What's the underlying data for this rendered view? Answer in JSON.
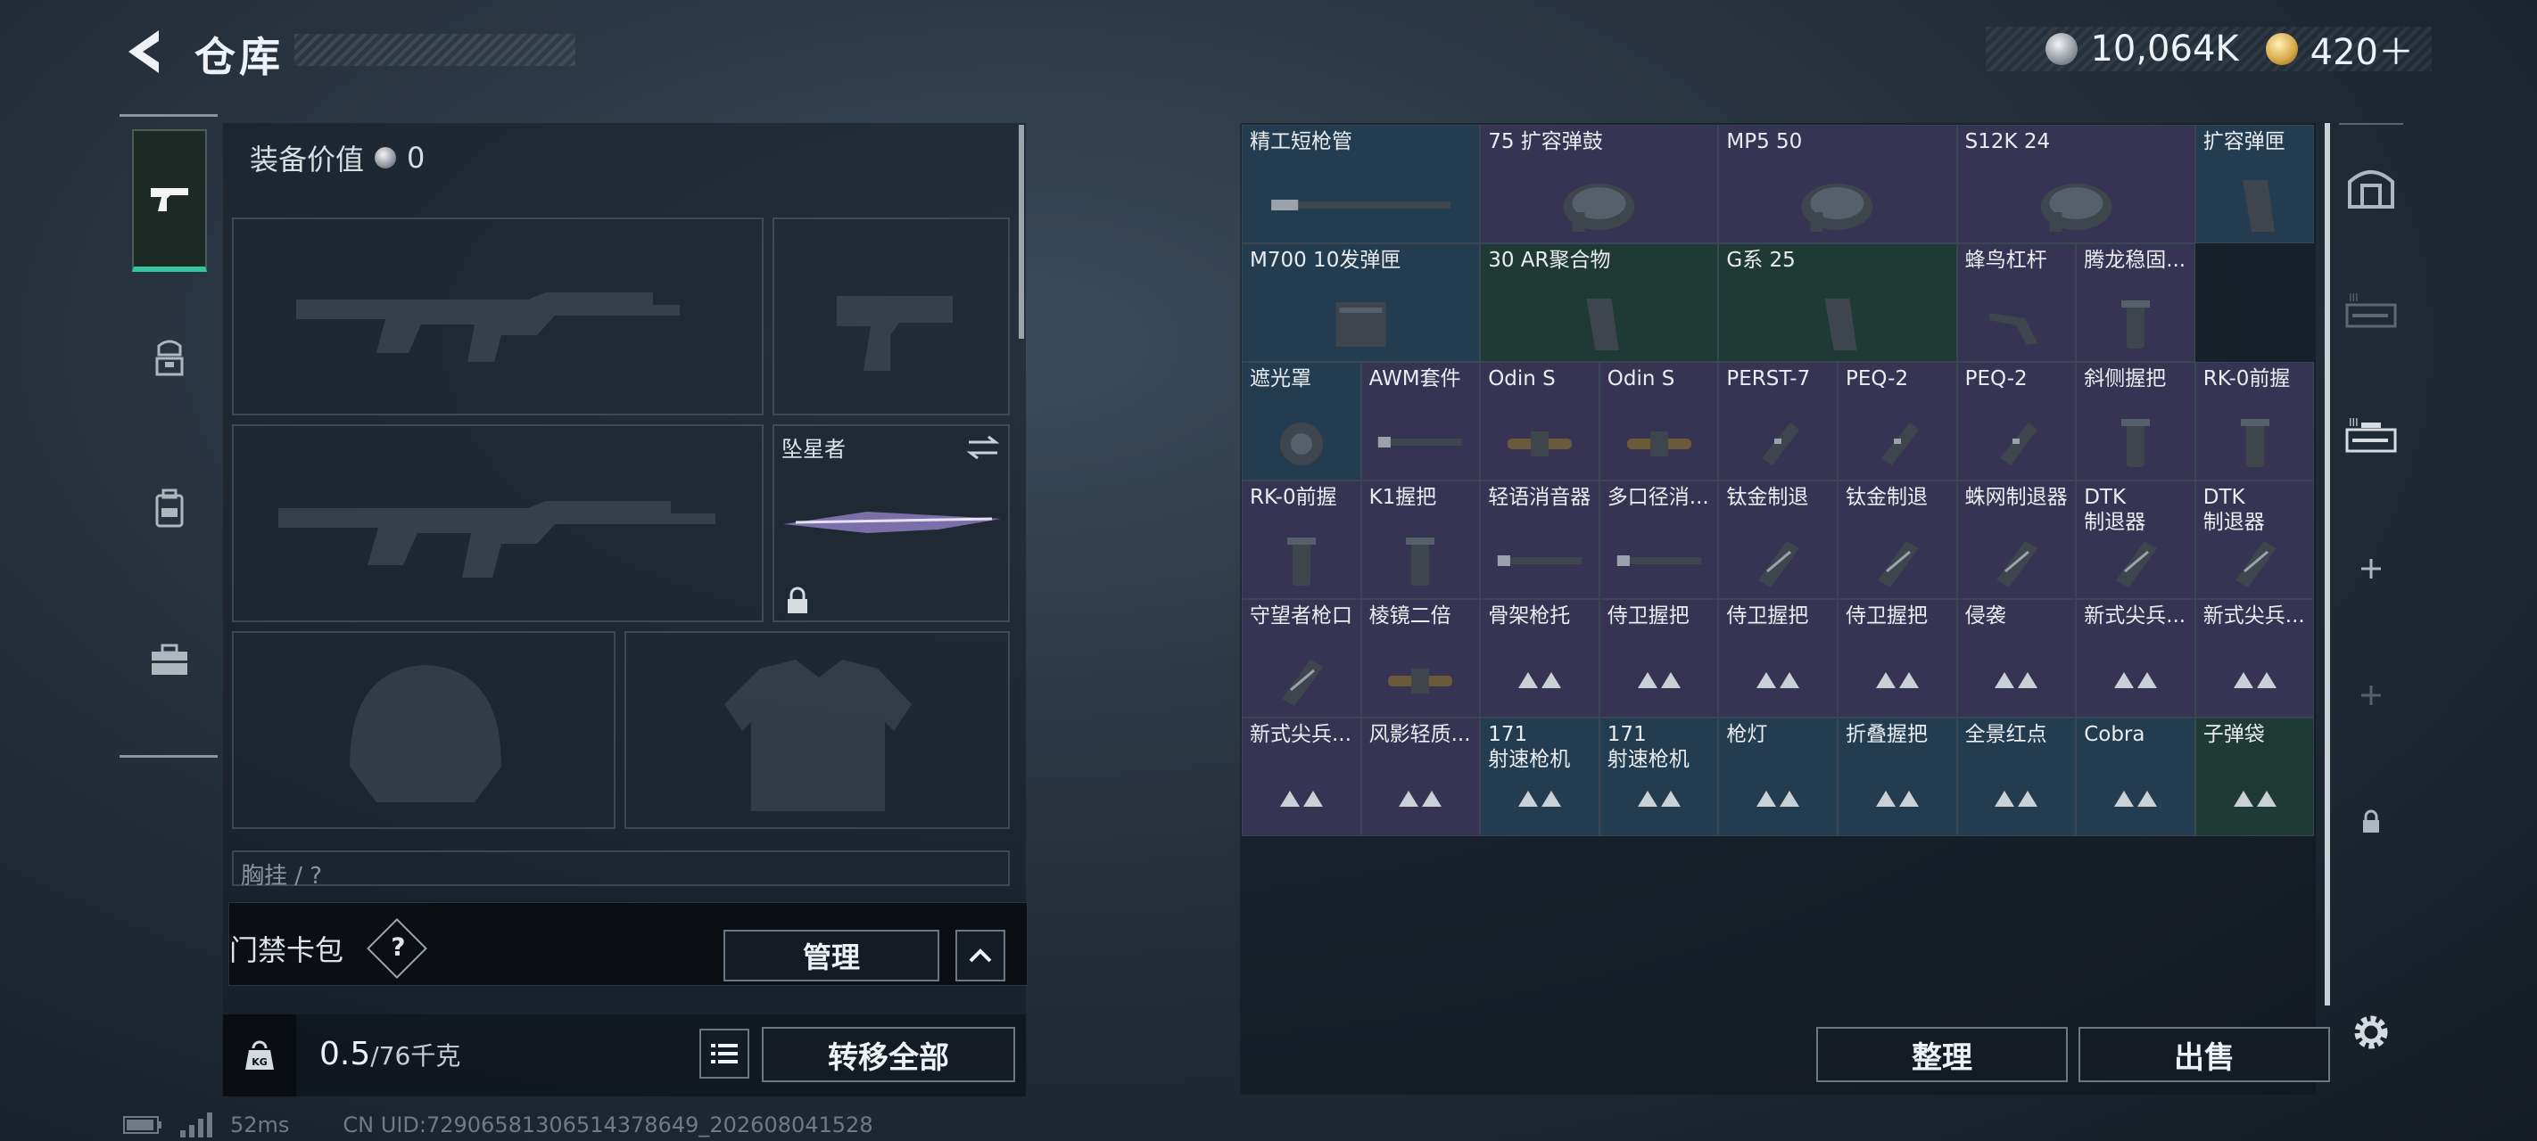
{
  "header": {
    "title": "仓库",
    "currency_silver": "10,064K",
    "currency_gold": "420＋"
  },
  "left_rail": {
    "tabs": [
      "weapon-icon",
      "helmet-vest-icon",
      "backpack-icon",
      "toolbox-icon"
    ]
  },
  "loadout": {
    "equip_value_label": "装备价值",
    "equip_value": "0",
    "melee_name": "坠星者",
    "chest_label": "胸挂 / ?",
    "access_card_label": "门禁卡包",
    "access_help": "?",
    "manage_button": "管理",
    "weight_value": "0.5",
    "weight_max": "/76千克",
    "transfer_all_button": "转移全部"
  },
  "status_bar": {
    "ping": "52ms",
    "uid": "CN UID:7290658130651437864​9_202608041528"
  },
  "stash": {
    "rows": [
      [
        {
          "name": "精工短枪管",
          "color": "blue",
          "art": "barrel"
        },
        {
          "name": "75 扩容弹鼓",
          "color": "purple",
          "art": "drum"
        },
        {
          "name": "MP5 50",
          "color": "purple",
          "art": "drum"
        },
        {
          "name": "S12K 24",
          "color": "purple",
          "art": "drum"
        },
        {
          "name": "扩容弹匣",
          "color": "blue",
          "art": "mag"
        }
      ],
      [
        {
          "name": "M700 10发弹匣",
          "color": "blue",
          "art": "box"
        },
        {
          "name": "30 AR聚合物",
          "color": "green",
          "art": "mag"
        },
        {
          "name": "G系 25",
          "color": "green",
          "art": "mag"
        },
        {
          "name": "蜂鸟杠杆",
          "color": "purple",
          "art": "lever"
        },
        {
          "name": "腾龙稳固...",
          "color": "purple",
          "art": "grip"
        }
      ],
      [
        {
          "name": "遮光罩",
          "color": "blue",
          "art": "hood"
        },
        {
          "name": "AWM套件",
          "color": "purple",
          "art": "barrel"
        },
        {
          "name": "Odin S",
          "color": "purple",
          "art": "scope"
        },
        {
          "name": "Odin S",
          "color": "purple",
          "art": "scope"
        },
        {
          "name": "PERST-7",
          "color": "purple",
          "art": "laser"
        },
        {
          "name": "PEQ-2",
          "color": "purple",
          "art": "laser"
        },
        {
          "name": "PEQ-2",
          "color": "purple",
          "art": "laser"
        },
        {
          "name": "斜侧握把",
          "color": "purple",
          "art": "grip"
        },
        {
          "name": "RK-0前握",
          "color": "purple",
          "art": "grip"
        }
      ],
      [
        {
          "name": "RK-0前握",
          "color": "purple",
          "art": "grip"
        },
        {
          "name": "K1握把",
          "color": "purple",
          "art": "grip"
        },
        {
          "name": "轻语消音器",
          "color": "purple",
          "art": "barrel"
        },
        {
          "name": "多口径消...",
          "color": "purple",
          "art": "barrel"
        },
        {
          "name": "钛金制退",
          "color": "purple",
          "art": "brake"
        },
        {
          "name": "钛金制退",
          "color": "purple",
          "art": "brake"
        },
        {
          "name": "蛛网制退器",
          "color": "purple",
          "art": "brake"
        },
        {
          "name": "DTK\n制退器",
          "color": "purple",
          "art": "brake"
        },
        {
          "name": "DTK\n制退器",
          "color": "purple",
          "art": "brake"
        }
      ],
      [
        {
          "name": "守望者枪口",
          "color": "purple",
          "art": "brake"
        },
        {
          "name": "棱镜二倍",
          "color": "purple",
          "art": "scope"
        },
        {
          "name": "骨架枪托",
          "color": "purple",
          "art": "tri"
        },
        {
          "name": "侍卫握把",
          "color": "purple",
          "art": "tri"
        },
        {
          "name": "侍卫握把",
          "color": "purple",
          "art": "tri"
        },
        {
          "name": "侍卫握把",
          "color": "purple",
          "art": "tri"
        },
        {
          "name": "侵袭",
          "color": "purple",
          "art": "tri"
        },
        {
          "name": "新式尖兵...",
          "color": "purple",
          "art": "tri"
        },
        {
          "name": "新式尖兵...",
          "color": "purple",
          "art": "tri"
        }
      ],
      [
        {
          "name": "新式尖兵...",
          "color": "purple",
          "art": "tri"
        },
        {
          "name": "风影轻质...",
          "color": "purple",
          "art": "tri"
        },
        {
          "name": "171\n射速枪机",
          "color": "blue",
          "art": "tri"
        },
        {
          "name": "171\n射速枪机",
          "color": "blue",
          "art": "tri"
        },
        {
          "name": "枪灯",
          "color": "blue",
          "art": "tri"
        },
        {
          "name": "折叠握把",
          "color": "blue",
          "art": "tri"
        },
        {
          "name": "全景红点",
          "color": "blue",
          "art": "tri"
        },
        {
          "name": "Cobra",
          "color": "blue",
          "art": "tri"
        },
        {
          "name": "子弹袋",
          "color": "green",
          "art": "tri"
        }
      ]
    ],
    "sort_button": "整理",
    "sell_button": "出售"
  },
  "right_rail": {
    "icons": [
      "safe-box-icon",
      "rifle-case-icon",
      "scoped-rifle-icon",
      "add-icon",
      "add-icon-disabled",
      "lock-icon"
    ]
  },
  "colors": {
    "accent_green": "#33c6a0",
    "cell_blue": "#233c50",
    "cell_purple": "#363452",
    "cell_green": "#1f3a35"
  }
}
